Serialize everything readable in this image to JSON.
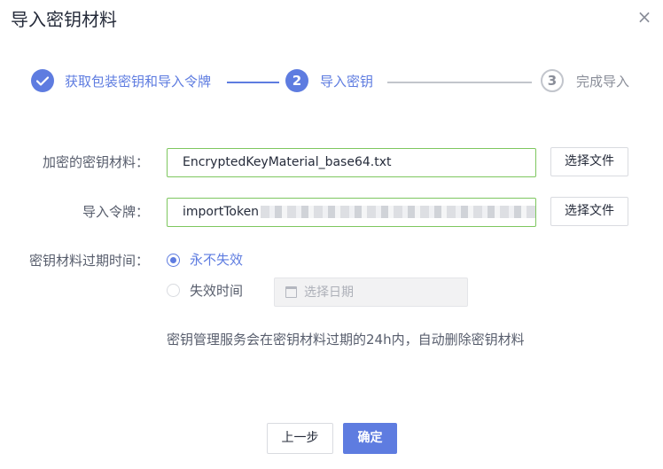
{
  "dialog": {
    "title": "导入密钥材料",
    "close_glyph": "×"
  },
  "steps": [
    {
      "label": "获取包装密钥和导入令牌",
      "state": "done",
      "icon": "check-icon"
    },
    {
      "number": "2",
      "label": "导入密钥",
      "state": "active"
    },
    {
      "number": "3",
      "label": "完成导入",
      "state": "wait"
    }
  ],
  "form": {
    "encrypted_material": {
      "label": "加密的密钥材料：",
      "value": "EncryptedKeyMaterial_base64.txt",
      "button": "选择文件"
    },
    "import_token": {
      "label": "导入令牌：",
      "value": "importToken",
      "button": "选择文件"
    },
    "expiration": {
      "label": "密钥材料过期时间：",
      "options": [
        {
          "label": "永不失效",
          "selected": true
        },
        {
          "label": "失效时间",
          "selected": false
        }
      ],
      "date_placeholder": "选择日期"
    },
    "hint": "密钥管理服务会在密钥材料过期的24h内，自动删除密钥材料"
  },
  "footer": {
    "prev_label": "上一步",
    "confirm_label": "确定"
  },
  "colors": {
    "accent": "#5e7ce0",
    "valid_border": "#7ec75f",
    "inactive": "#c2c5cc"
  }
}
